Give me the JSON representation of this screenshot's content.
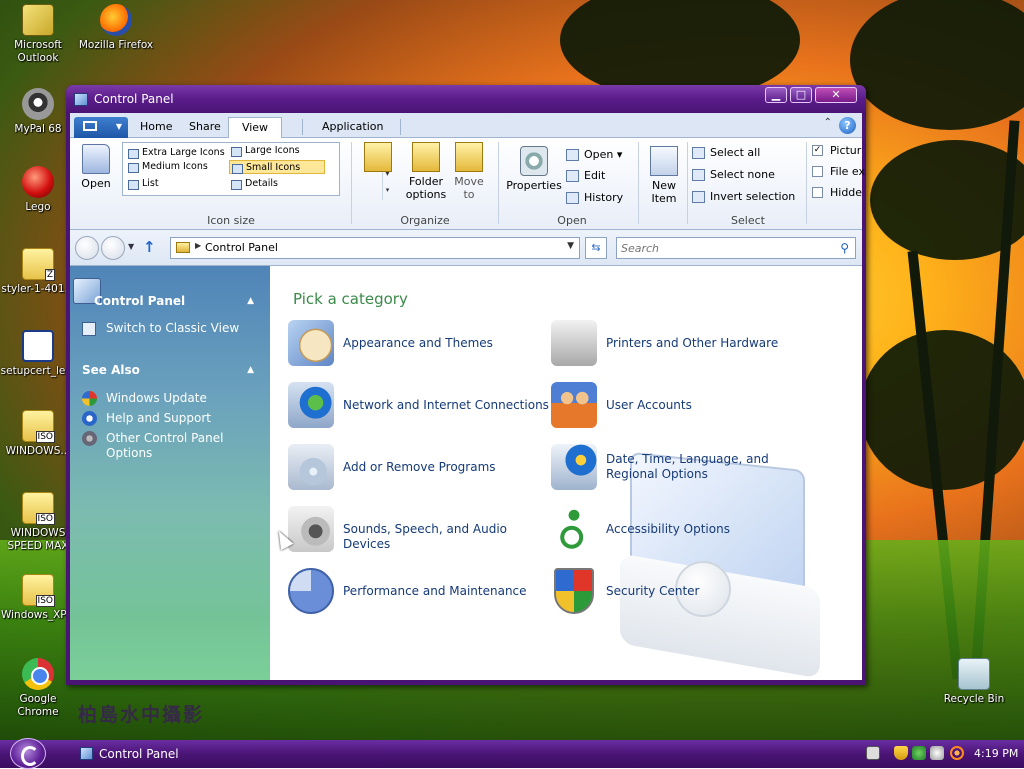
{
  "desktop": {
    "icons": [
      {
        "label": "Microsoft Outlook",
        "icon": "outlook-icon"
      },
      {
        "label": "Mozilla Firefox",
        "icon": "firefox-icon"
      },
      {
        "label": "MyPal 68",
        "icon": "mypal-icon"
      },
      {
        "label": "Lego",
        "icon": "lego-icon"
      },
      {
        "label": "styler-1-401...",
        "icon": "zip-folder-icon"
      },
      {
        "label": "setupcert_le...",
        "icon": "setup-window-icon"
      },
      {
        "label": "WINDOWS...",
        "icon": "iso-file-icon"
      },
      {
        "label": "WINDOWS SPEED MAX",
        "icon": "iso-file-icon"
      },
      {
        "label": "Windows_XP...",
        "icon": "iso-file-icon"
      },
      {
        "label": "Google Chrome",
        "icon": "chrome-icon"
      },
      {
        "label": "Recycle Bin",
        "icon": "recycle-bin-icon"
      }
    ],
    "iso_tag": "ISO",
    "zip_tag": "Z",
    "watermark": "柏島水中攝影"
  },
  "window": {
    "title": "Control Panel",
    "controls": {
      "minimize": "▁",
      "maximize": "□",
      "close": "✕"
    }
  },
  "ribbon": {
    "tabs": [
      {
        "label": "Home"
      },
      {
        "label": "Share"
      },
      {
        "label": "View"
      },
      {
        "label": "Application"
      }
    ],
    "help": "?",
    "collapse": "⌃",
    "groups": {
      "open_btn": "Open",
      "icon_size": {
        "label": "Icon size",
        "options": [
          "Extra Large Icons",
          "Large Icons",
          "Medium Icons",
          "Small Icons",
          "List",
          "Details"
        ],
        "selected": "Small Icons"
      },
      "organize": {
        "label": "Organize",
        "folder_options": "Folder options",
        "move_to": "Move to"
      },
      "open": {
        "label": "Open",
        "properties": "Properties",
        "open": "Open",
        "edit": "Edit",
        "history": "History"
      },
      "new_item": "New Item",
      "select": {
        "label": "Select",
        "select_all": "Select all",
        "select_none": "Select none",
        "invert": "Invert selection"
      },
      "show_hide": {
        "picture": "Pictur",
        "file_ext": "File ex",
        "hidden": "Hidde"
      }
    }
  },
  "address": {
    "path": "Control Panel",
    "search_placeholder": "Search"
  },
  "leftpane": {
    "cp_header": "Control Panel",
    "switch": "Switch to Classic View",
    "see_also": "See Also",
    "links": [
      "Windows Update",
      "Help and Support",
      "Other Control Panel Options"
    ]
  },
  "content": {
    "pick": "Pick a category",
    "categories_left": [
      "Appearance and Themes",
      "Network and Internet Connections",
      "Add or Remove Programs",
      "Sounds, Speech, and Audio Devices",
      "Performance and Maintenance"
    ],
    "categories_right": [
      "Printers and Other Hardware",
      "User Accounts",
      "Date, Time, Language, and Regional Options",
      "Accessibility Options",
      "Security Center"
    ]
  },
  "taskbar": {
    "task_label": "Control Panel",
    "clock": "4:19 PM"
  }
}
